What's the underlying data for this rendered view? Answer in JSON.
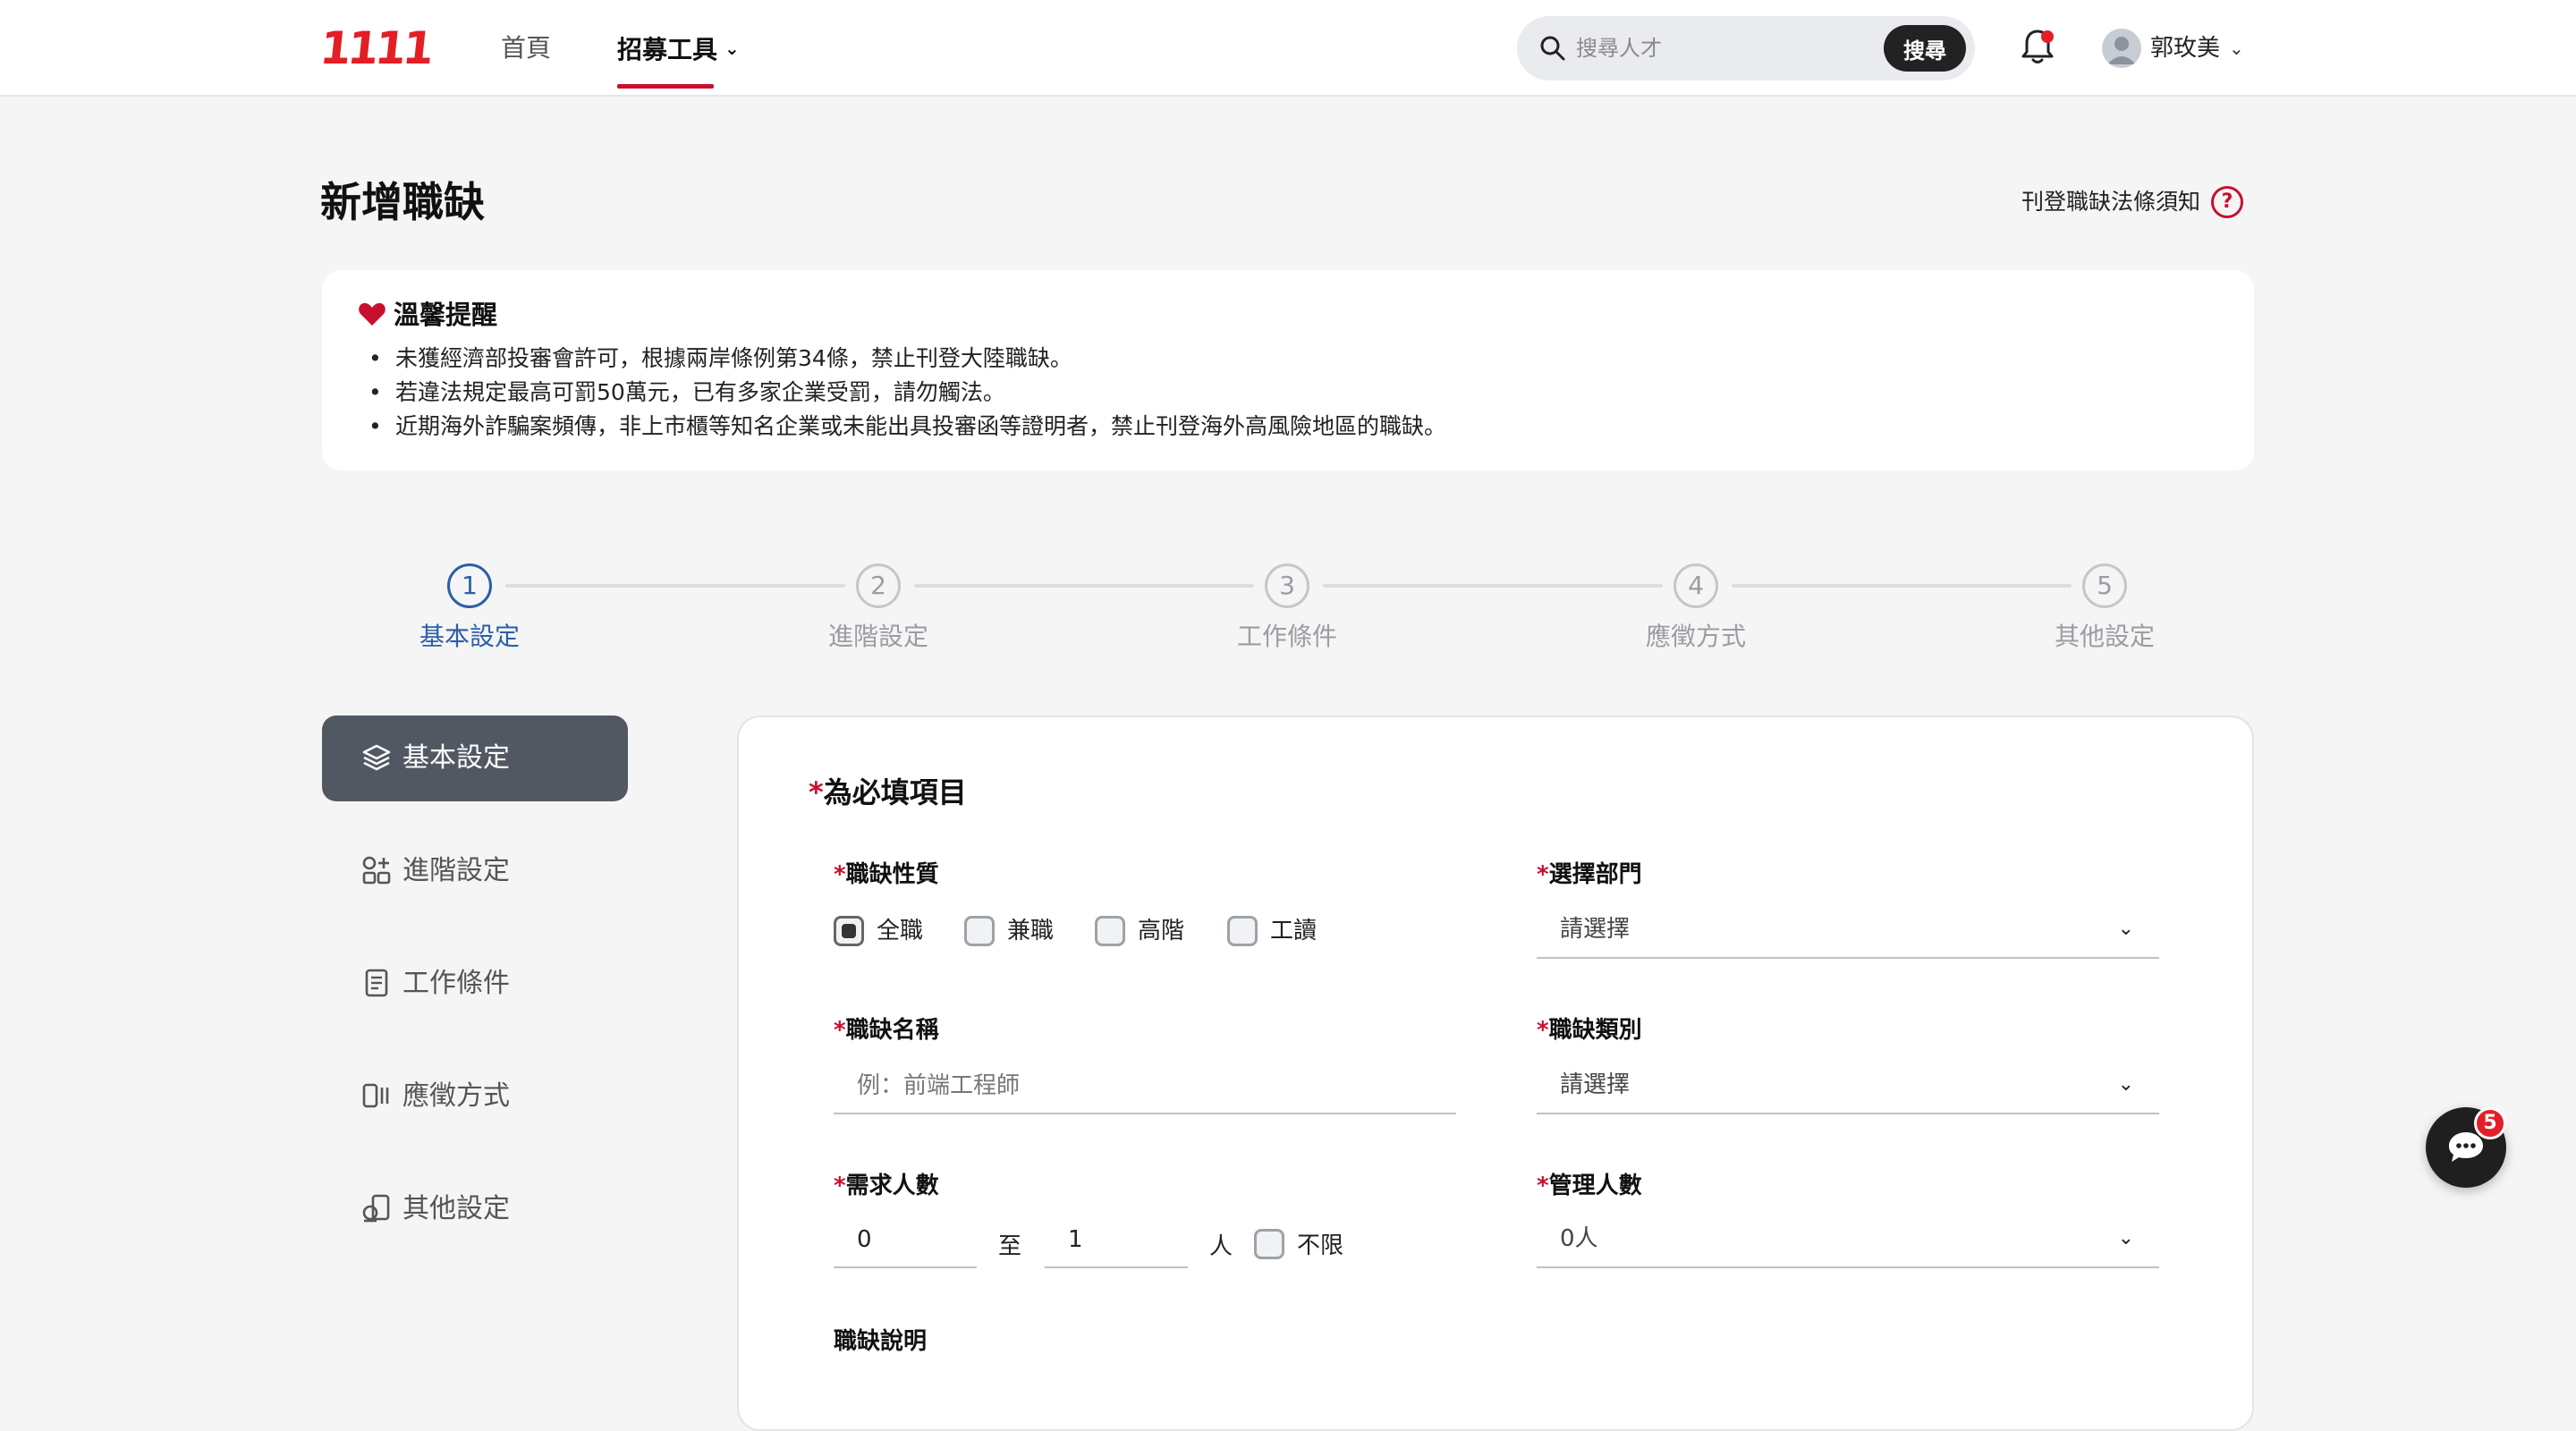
{
  "header": {
    "logo": "1111",
    "nav": [
      {
        "label": "首頁"
      },
      {
        "label": "招募工具"
      }
    ],
    "search": {
      "placeholder": "搜尋人才",
      "button": "搜尋"
    },
    "user": {
      "name": "郭玫美"
    }
  },
  "page": {
    "title": "新增職缺",
    "law_link": "刊登職缺法條須知"
  },
  "notice": {
    "title": "溫馨提醒",
    "items": [
      "未獲經濟部投審會許可，根據兩岸條例第34條，禁止刊登大陸職缺。",
      "若違法規定最高可罰50萬元，已有多家企業受罰，請勿觸法。",
      "近期海外詐騙案頻傳，非上市櫃等知名企業或未能出具投審函等證明者，禁止刊登海外高風險地區的職缺。"
    ]
  },
  "steps": [
    {
      "num": "1",
      "label": "基本設定",
      "active": true
    },
    {
      "num": "2",
      "label": "進階設定",
      "active": false
    },
    {
      "num": "3",
      "label": "工作條件",
      "active": false
    },
    {
      "num": "4",
      "label": "應徵方式",
      "active": false
    },
    {
      "num": "5",
      "label": "其他設定",
      "active": false
    }
  ],
  "sidebar": [
    {
      "label": "基本設定",
      "icon": "layers-icon",
      "active": true
    },
    {
      "label": "進階設定",
      "icon": "grid-plus-icon",
      "active": false
    },
    {
      "label": "工作條件",
      "icon": "document-icon",
      "active": false
    },
    {
      "label": "應徵方式",
      "icon": "apply-icon",
      "active": false
    },
    {
      "label": "其他設定",
      "icon": "settings-shapes-icon",
      "active": false
    }
  ],
  "form": {
    "required_note": "為必填項目",
    "job_nature": {
      "label": "職缺性質",
      "options": [
        {
          "label": "全職",
          "checked": true
        },
        {
          "label": "兼職",
          "checked": false
        },
        {
          "label": "高階",
          "checked": false
        },
        {
          "label": "工讀",
          "checked": false
        }
      ]
    },
    "department": {
      "label": "選擇部門",
      "value": "請選擇"
    },
    "job_name": {
      "label": "職缺名稱",
      "placeholder": "例：前端工程師"
    },
    "job_category": {
      "label": "職缺類別",
      "value": "請選擇"
    },
    "headcount": {
      "label": "需求人數",
      "min": "0",
      "to": "至",
      "max": "1",
      "unit": "人",
      "unlimited": "不限"
    },
    "manage_count": {
      "label": "管理人數",
      "value": "0人"
    },
    "description": {
      "label": "職缺說明"
    }
  },
  "chat": {
    "badge": "5"
  },
  "colors": {
    "brand_red": "#e41e26",
    "accent_blue": "#2c5fa8",
    "sidebar_active": "#525862"
  }
}
